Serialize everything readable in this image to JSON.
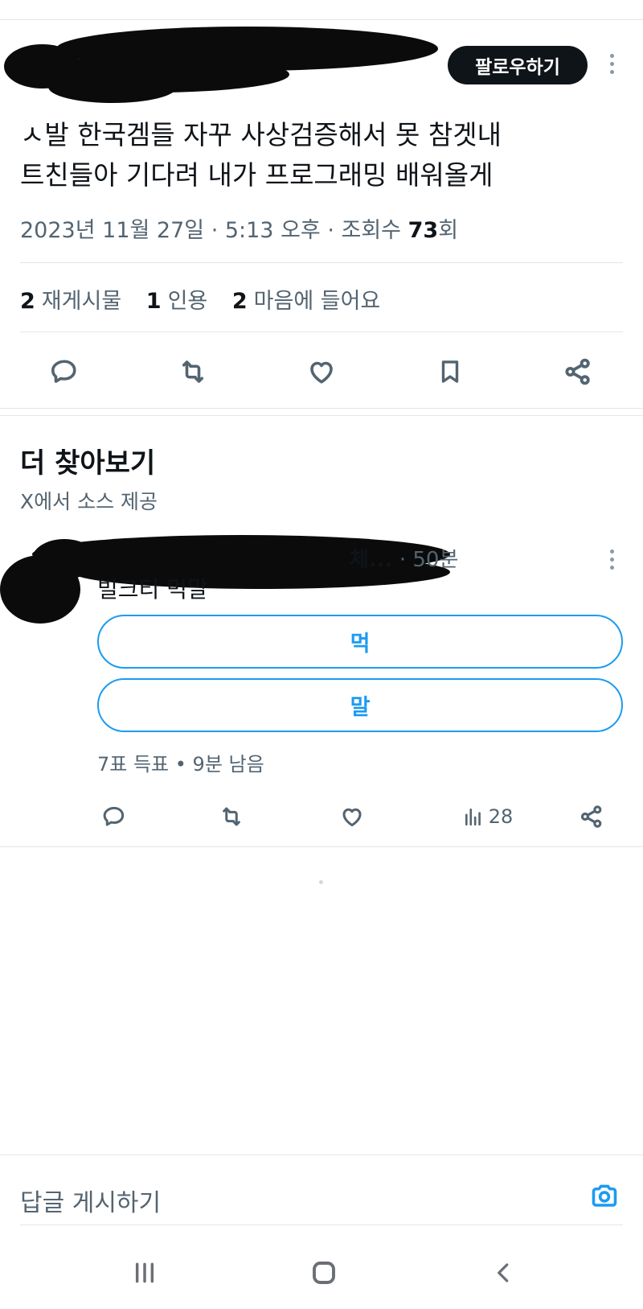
{
  "post": {
    "follow_label": "팔로우하기",
    "text_line1": "ㅅ발 한국겜들 자꾸 사상검증해서 못 참겟내",
    "text_line2": "트친들아 기다려 내가 프로그래밍 배워올게",
    "meta_prefix": "2023년 11월 27일 · 5:13 오후 · 조회수 ",
    "views": "73",
    "views_suffix": "회",
    "reposts_count": "2",
    "reposts_label": "재게시물",
    "quotes_count": "1",
    "quotes_label": "인용",
    "likes_count": "2",
    "likes_label": "마음에 들어요"
  },
  "explore": {
    "title": "더 찾아보기",
    "subtitle": "X에서 소스 제공"
  },
  "tweet2": {
    "author_tail": "체...",
    "time": " · 50분",
    "text": "빌크티 먹말",
    "poll_options": [
      "먹",
      "말"
    ],
    "poll_meta": "7표 득표 • 9분 남음",
    "views": "28"
  },
  "reply": {
    "placeholder": "답글 게시하기"
  },
  "icons": {
    "reply": "reply-icon",
    "repost": "repost-icon",
    "like": "heart-icon",
    "bookmark": "bookmark-icon",
    "share": "share-icon",
    "views": "views-icon",
    "camera": "camera-icon",
    "more": "more-icon"
  },
  "colors": {
    "accent": "#1d9bf0",
    "text": "#0f1419",
    "secondary": "#536471"
  }
}
